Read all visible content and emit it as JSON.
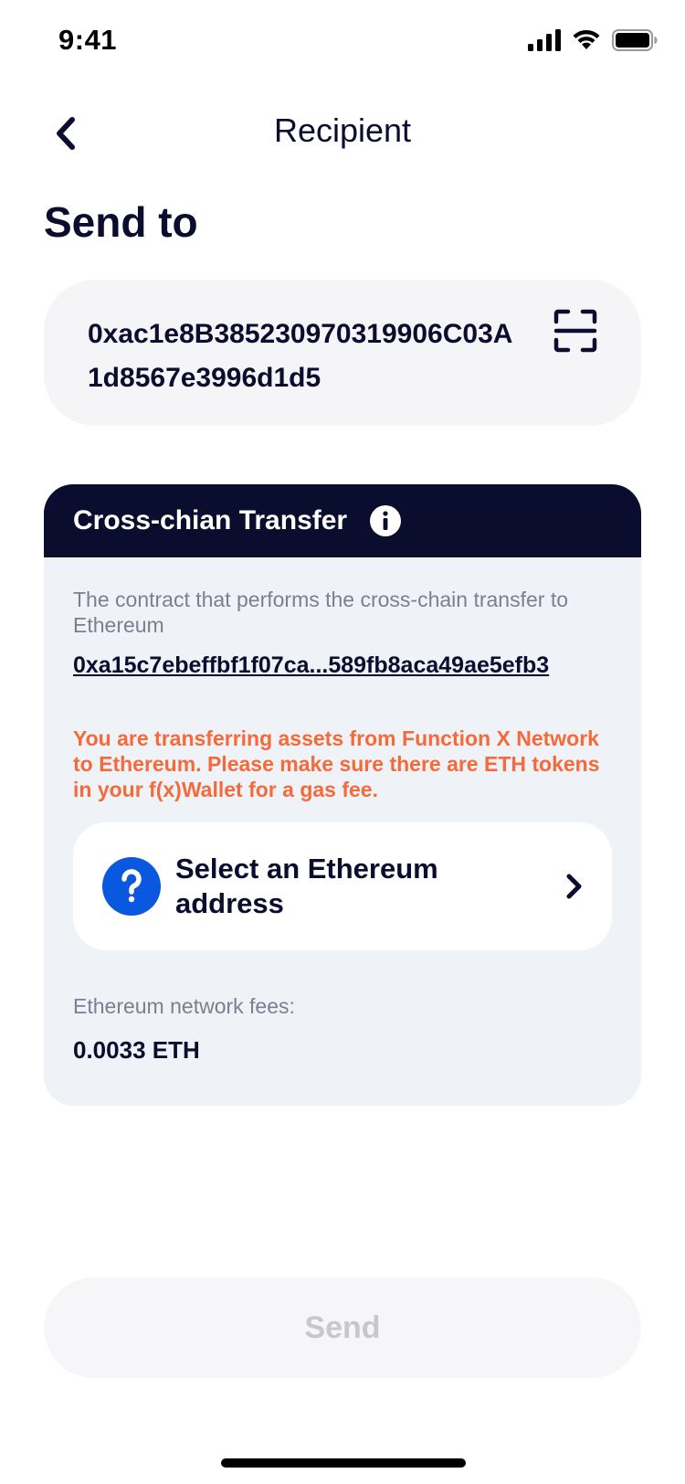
{
  "status_bar": {
    "time": "9:41",
    "icons": [
      "cellular-signal-icon",
      "wifi-icon",
      "battery-icon"
    ]
  },
  "nav": {
    "back_icon": "chevron-left-icon",
    "title": "Recipient"
  },
  "page_title": "Send to",
  "address_input": {
    "value": "0xac1e8B385230970319906C03A1d8567e3996d1d5",
    "scan_icon": "scan-qr-icon"
  },
  "cross_chain": {
    "title": "Cross-chian Transfer",
    "info_icon": "info-icon",
    "contract_description": "The contract that performs the cross-chain transfer to Ethereum",
    "contract_address": "0xa15c7ebeffbf1f07ca...589fb8aca49ae5efb3",
    "warning": "You are transferring assets from Function X Network to Ethereum. Please make sure there are ETH tokens in your f(x)Wallet for a gas fee.",
    "select_address": {
      "icon": "question-icon",
      "label": "Select an Ethereum address",
      "chevron_icon": "chevron-right-icon"
    },
    "fee_label": "Ethereum network fees:",
    "fee_value": "0.0033 ETH"
  },
  "send_button": {
    "label": "Send",
    "enabled": false
  },
  "colors": {
    "primary_dark": "#0b0d2e",
    "warning_orange": "#f46a3b",
    "accent_blue": "#0a57e0",
    "card_background": "#eff2f6",
    "input_background": "#f5f5f8",
    "muted_text": "#7a7f92",
    "disabled_text": "#c6c7cf"
  }
}
